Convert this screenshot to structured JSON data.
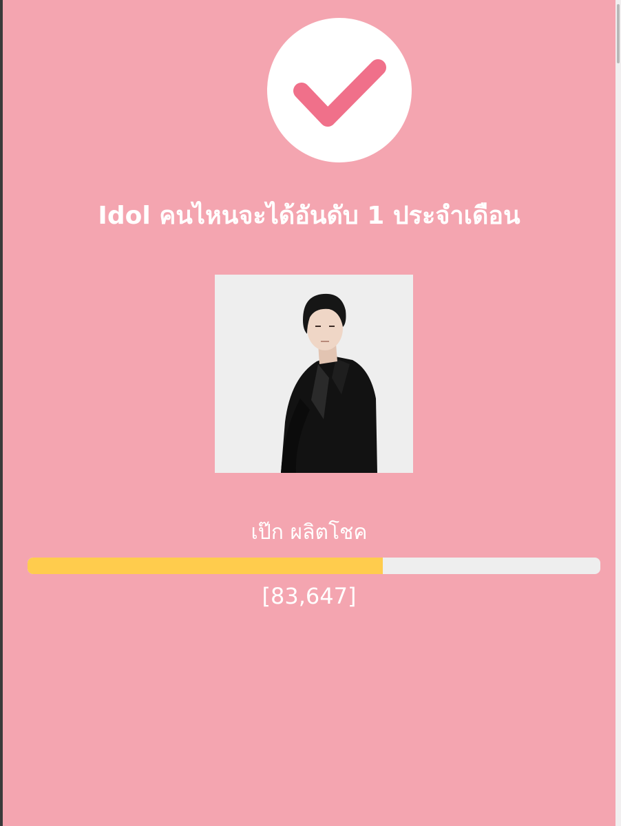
{
  "poll": {
    "title": "Idol คนไหนจะได้อันดับ 1 ประจำเดือน",
    "result": {
      "name": "เป๊ก ผลิตโชค",
      "votes_label": "[83,647]",
      "progress_fraction": 0.62
    }
  },
  "icons": {
    "status": "check-icon"
  },
  "colors": {
    "background": "#f4a5b0",
    "accent": "#f0708a",
    "progress_fill": "#ffcc4d",
    "progress_track": "#eeeeee",
    "text": "#ffffff"
  }
}
